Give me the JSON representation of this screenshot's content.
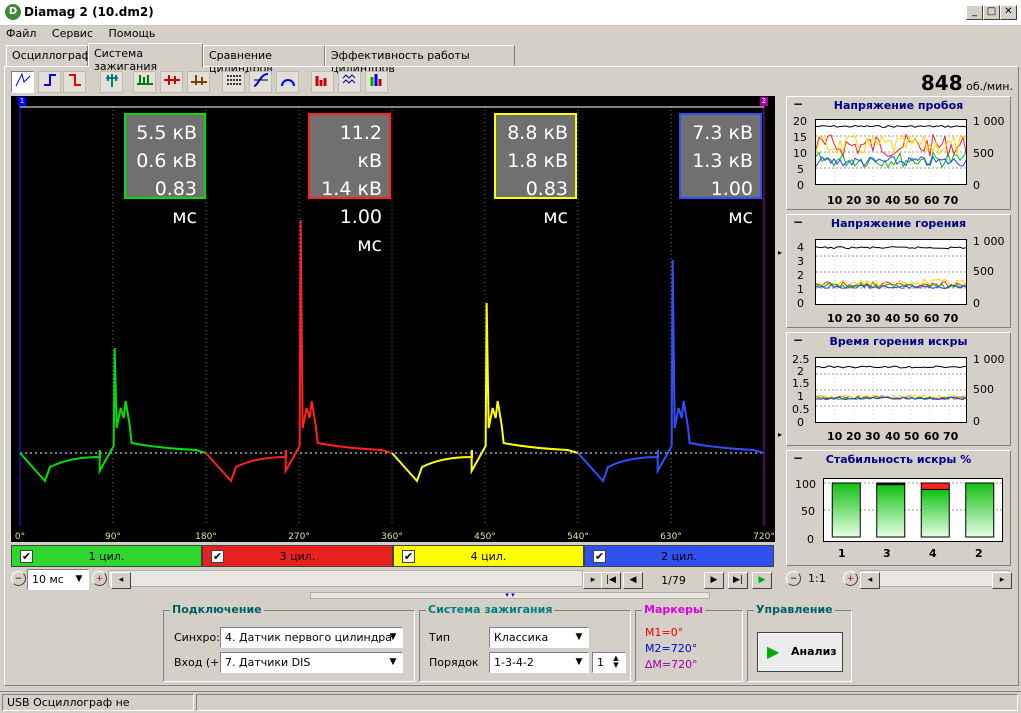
{
  "window": {
    "title": "Diamag 2 (10.dm2)"
  },
  "menu": [
    "Файл",
    "Сервис",
    "Помощь"
  ],
  "tabs": [
    "Осциллограф",
    "Система зажигания",
    "Сравнение цилиндров",
    "Эффективность работы цилиндров"
  ],
  "rpm": {
    "value": "848",
    "unit": "об./мин."
  },
  "scope": {
    "marker_left": "1",
    "marker_right": "2",
    "x_ticks": [
      "0°",
      "90°",
      "180°",
      "270°",
      "360°",
      "450°",
      "540°",
      "630°",
      "720°"
    ],
    "cylinders": [
      {
        "voltage": "5.5 кВ",
        "burn_voltage": "0.6 кВ",
        "burn_time": "0.83 мс",
        "color": "#00e000"
      },
      {
        "voltage": "11.2 кВ",
        "burn_voltage": "1.4 кВ",
        "burn_time": "1.00 мс",
        "color": "#ff2020"
      },
      {
        "voltage": "8.8 кВ",
        "burn_voltage": "1.8 кВ",
        "burn_time": "0.83 мс",
        "color": "#ffff00"
      },
      {
        "voltage": "7.3 кВ",
        "burn_voltage": "1.3 кВ",
        "burn_time": "1.00 мс",
        "color": "#3050ff"
      }
    ],
    "cylinder_bars": [
      {
        "label": "1 цил.",
        "color": "#2ed62e",
        "checked": "✔"
      },
      {
        "label": "3 цил.",
        "color": "#e82020",
        "checked": "✔"
      },
      {
        "label": "4 цил.",
        "color": "#ffff00",
        "checked": "✔"
      },
      {
        "label": "2 цил.",
        "color": "#3050f0",
        "checked": "✔"
      }
    ]
  },
  "timebase": {
    "value": "10 мс",
    "page": "1/79"
  },
  "panels": [
    {
      "title": "Напряжение пробоя",
      "y_left": [
        "20",
        "15",
        "10",
        "5",
        "0"
      ],
      "y_right": [
        "1 000",
        "500",
        "0"
      ],
      "x": [
        "10",
        "20",
        "30",
        "40",
        "50",
        "60",
        "70"
      ]
    },
    {
      "title": "Напряжение горения",
      "y_left": [
        "4",
        "3",
        "2",
        "1",
        "0"
      ],
      "y_right": [
        "1 000",
        "500",
        "0"
      ],
      "x": [
        "10",
        "20",
        "30",
        "40",
        "50",
        "60",
        "70"
      ]
    },
    {
      "title": "Время горения искры",
      "y_left": [
        "2.5",
        "2",
        "1.5",
        "1",
        "0.5",
        "0"
      ],
      "y_right": [
        "1 000",
        "500",
        "0"
      ],
      "x": [
        "10",
        "20",
        "30",
        "40",
        "50",
        "60",
        "70"
      ]
    },
    {
      "title": "Стабильность искры %",
      "y_left": [
        "100",
        "50",
        "0"
      ],
      "x": [
        "1",
        "3",
        "4",
        "2"
      ]
    }
  ],
  "chart_data": {
    "type": "bar",
    "title": "Стабильность искры %",
    "categories": [
      "1",
      "3",
      "4",
      "2"
    ],
    "values": [
      100,
      97,
      88,
      100
    ],
    "ylim": [
      0,
      100
    ]
  },
  "panel_zoom": "1:1",
  "connection": {
    "title": "Подключение",
    "sync_label": "Синхро:",
    "sync_value": "4.  Датчик первого цилиндра",
    "input_label": "Вход (+):",
    "input_value": "7.  Датчики DIS"
  },
  "ignition": {
    "title": "Система зажигания",
    "type_label": "Тип",
    "type_value": "Классика",
    "order_label": "Порядок",
    "order_value": "1-3-4-2",
    "order_num": "1"
  },
  "markers": {
    "title": "Маркеры",
    "m1": "M1=0°",
    "m2": "M2=720°",
    "dm": "∆M=720°"
  },
  "control": {
    "title": "Управление",
    "analyze": "Анализ"
  },
  "status": "USB Осциллограф не подключен"
}
